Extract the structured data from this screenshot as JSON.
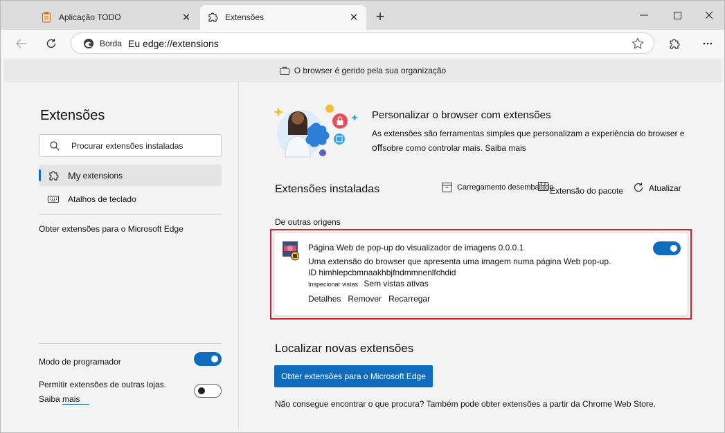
{
  "tabs": [
    {
      "label": "Aplicação TODO",
      "icon": "notepad-icon"
    },
    {
      "label": "Extensões",
      "icon": "puzzle-icon"
    }
  ],
  "address_bar": {
    "site_label": "Borda",
    "url": "Eu edge://extensions"
  },
  "banner": {
    "text": "O browser é gerido pela sua organização"
  },
  "sidebar": {
    "title": "Extensões",
    "search_placeholder": "Procurar extensões instaladas",
    "my_prefix": "My",
    "my_suffix": "extensions",
    "shortcuts_label": "Atalhos de teclado",
    "get_extensions_label": "Obter extensões para o Microsoft Edge",
    "dev_mode_label": "Modo de programador",
    "dev_mode_on": true,
    "other_stores_text": "Permitir extensões de outras lojas. Saiba",
    "other_stores_link": "mais",
    "other_stores_on": false
  },
  "hero": {
    "title": "Personalizar o browser com extensões",
    "desc_line1": "As extensões são ferramentas simples que personalizam a experiência do browser e",
    "desc_line2_prefix": "off",
    "desc_line2": "sobre como controlar mais. Saiba mais"
  },
  "installed": {
    "title": "Extensões instaladas",
    "actions": {
      "load_unpacked": "Carregamento desembalado",
      "pack": "Extensão do pacote",
      "update": "Atualizar"
    },
    "section_label": "De outras origens",
    "extension": {
      "name": "Página Web de pop-up do visualizador de imagens 0.0.0.1",
      "description": "Uma extensão do browser que apresenta uma imagem numa página Web pop-up.",
      "id_label": "ID himhlepcbmnaakhbjfndmmnenlfchdid",
      "inspect_label": "Inspecionar vistas",
      "inspect_value": "Sem vistas ativas",
      "links": [
        "Detalhes",
        "Remover",
        "Recarregar"
      ],
      "enabled": true
    }
  },
  "find": {
    "title": "Localizar novas extensões",
    "button": "Obter extensões para o Microsoft Edge",
    "cant_find": "Não consegue encontrar o que procura? Também pode obter extensões a partir da Chrome Web Store."
  },
  "colors": {
    "accent": "#0f6cbd",
    "highlight": "#d61f2b"
  }
}
